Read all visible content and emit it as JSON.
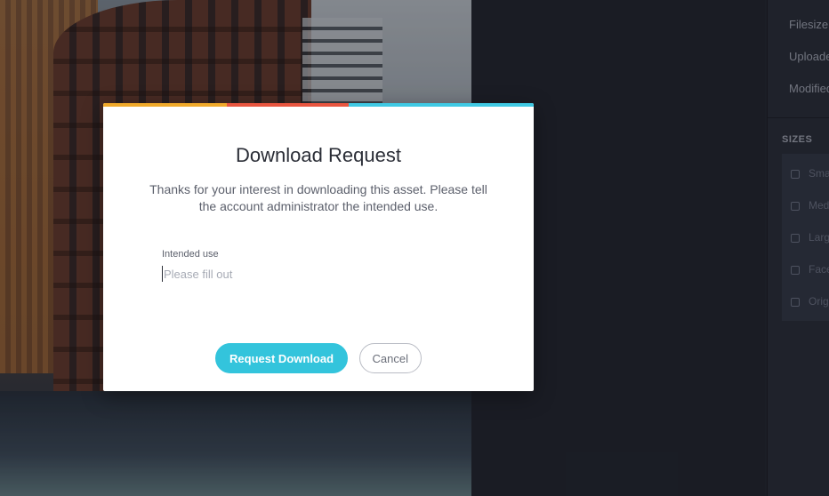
{
  "sidebar": {
    "meta": [
      "Filesize",
      "Uploaded",
      "Modified"
    ],
    "sizes_heading": "SIZES",
    "sizes": [
      "Small",
      "Medium",
      "Large",
      "Facebook",
      "Original"
    ]
  },
  "modal": {
    "accent_colors": [
      "#f0a92a",
      "#e8553f",
      "#3fc9e3"
    ],
    "title": "Download Request",
    "description": "Thanks for your interest in downloading this asset. Please tell the account administrator the intended use.",
    "field_label": "Intended use",
    "field_placeholder": "Please fill out",
    "field_value": "",
    "primary_button": "Request Download",
    "secondary_button": "Cancel"
  }
}
